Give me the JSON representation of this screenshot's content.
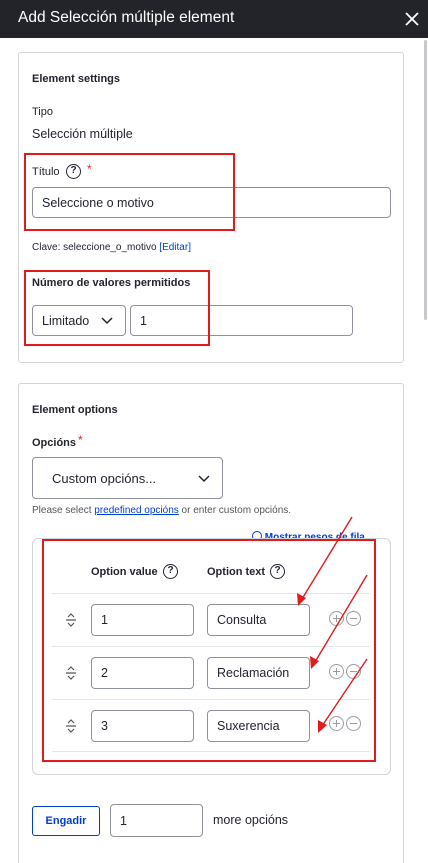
{
  "dialog": {
    "title": "Add Selección múltiple element"
  },
  "element_settings": {
    "legend": "Element settings",
    "tipo_label": "Tipo",
    "tipo_value": "Selección múltiple",
    "titulo_label": "Título",
    "titulo_value": "Seleccione o motivo",
    "clave_text": "Clave: seleccione_o_motivo",
    "clave_link": "[Editar]",
    "numero_label": "Número de valores permitidos",
    "numero_select": "Limitado",
    "numero_value": "1"
  },
  "element_options": {
    "legend": "Element options",
    "opcions_label": "Opcións",
    "opcions_select": "Custom opcións...",
    "helper_prefix": "Please select ",
    "helper_link": "predefined opcións",
    "helper_suffix": " or enter custom opcións.",
    "show_weights": "Mostrar pesos de fila",
    "columns": {
      "value": "Option value",
      "text": "Option text"
    },
    "rows": [
      {
        "value": "1",
        "text": "Consulta"
      },
      {
        "value": "2",
        "text": "Reclamación"
      },
      {
        "value": "3",
        "text": "Suxerencia"
      }
    ],
    "add_button": "Engadir",
    "add_count": "1",
    "more_label": "more opcións"
  },
  "colors": {
    "titlebar_bg": "#232429",
    "annotation_red": "#e01b1b",
    "link_blue": "#003ecc"
  }
}
